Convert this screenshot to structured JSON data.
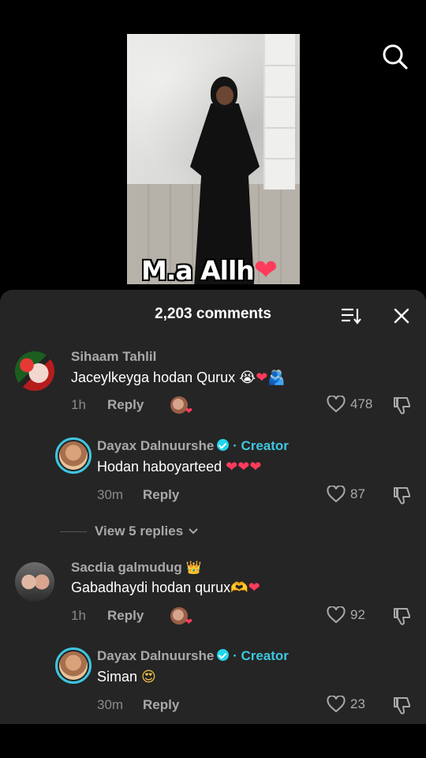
{
  "video": {
    "caption_text": "M.a Allh",
    "caption_emoji": "❤"
  },
  "sheet": {
    "title": "2,203 comments"
  },
  "comments": [
    {
      "username": "Sihaam Tahlil",
      "text": "Jaceylkeyga hodan Qurux",
      "emojis": [
        "😭",
        "❤",
        "🫂"
      ],
      "time": "1h",
      "reply_label": "Reply",
      "likes": "478"
    },
    {
      "username": "Dayax Dalnuurshe",
      "creator_label": "· Creator",
      "text": "Hodan haboyarteed",
      "emojis": [
        "❤",
        "❤",
        "❤"
      ],
      "time": "30m",
      "reply_label": "Reply",
      "likes": "87"
    },
    {
      "username": "Sacdia galmudug",
      "username_emoji": "👑",
      "text": "Gabadhaydi hodan qurux",
      "emojis": [
        "🫶",
        "❤"
      ],
      "time": "1h",
      "reply_label": "Reply",
      "likes": "92"
    },
    {
      "username": "Dayax Dalnuurshe",
      "creator_label": "· Creator",
      "text": "Siman",
      "emojis": [
        "😍"
      ],
      "time": "30m",
      "reply_label": "Reply",
      "likes": "23"
    }
  ],
  "view_replies_label": "View 5 replies",
  "colors": {
    "sheet_bg": "#252525",
    "accent_creator": "#3ec6e0",
    "heart_red": "#ff3b5c",
    "muted_text": "#a9a9a9"
  },
  "icons": [
    "search-icon",
    "sort-icon",
    "close-icon",
    "heart-outline-icon",
    "dislike-icon",
    "verified-icon",
    "chevron-down-icon"
  ]
}
